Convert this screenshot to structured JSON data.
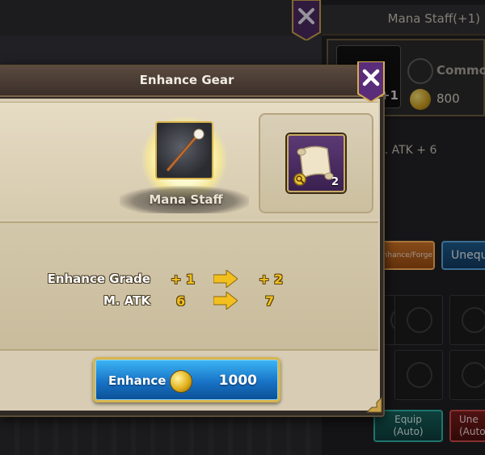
{
  "background": {
    "item_title": "Mana Staff(+1)",
    "item_plus": "+1",
    "rarity": "Commo",
    "price": "800",
    "stat_line": "M. ATK + 6",
    "button_enhance_forge": "Enhance/Forge",
    "button_unequip": "Unequ",
    "button_equip_auto_line1": "Equip",
    "button_equip_auto_line2": "(Auto)",
    "button_unequip_auto_line1": "Une",
    "button_unequip_auto_line2": "(Auto"
  },
  "dialog": {
    "title": "Enhance Gear",
    "item_name": "Mana Staff",
    "material_count": "2",
    "stats": [
      {
        "label": "Enhance Grade",
        "from": "+ 1",
        "to": "+ 2"
      },
      {
        "label": "M. ATK",
        "from": "6",
        "to": "7"
      }
    ],
    "enhance_button": {
      "label": "Enhance",
      "cost": "1000"
    }
  },
  "colors": {
    "accent_gold": "#f2c01e",
    "button_blue": "#1873c6",
    "badge_purple": "#5a2d7a",
    "parchment": "#d8cdb4"
  },
  "icons": {
    "close": "close-x-icon",
    "item": "mana-staff-icon",
    "material": "enhance-scroll-icon",
    "coin": "gold-coin-icon",
    "arrow": "right-arrow-icon"
  }
}
